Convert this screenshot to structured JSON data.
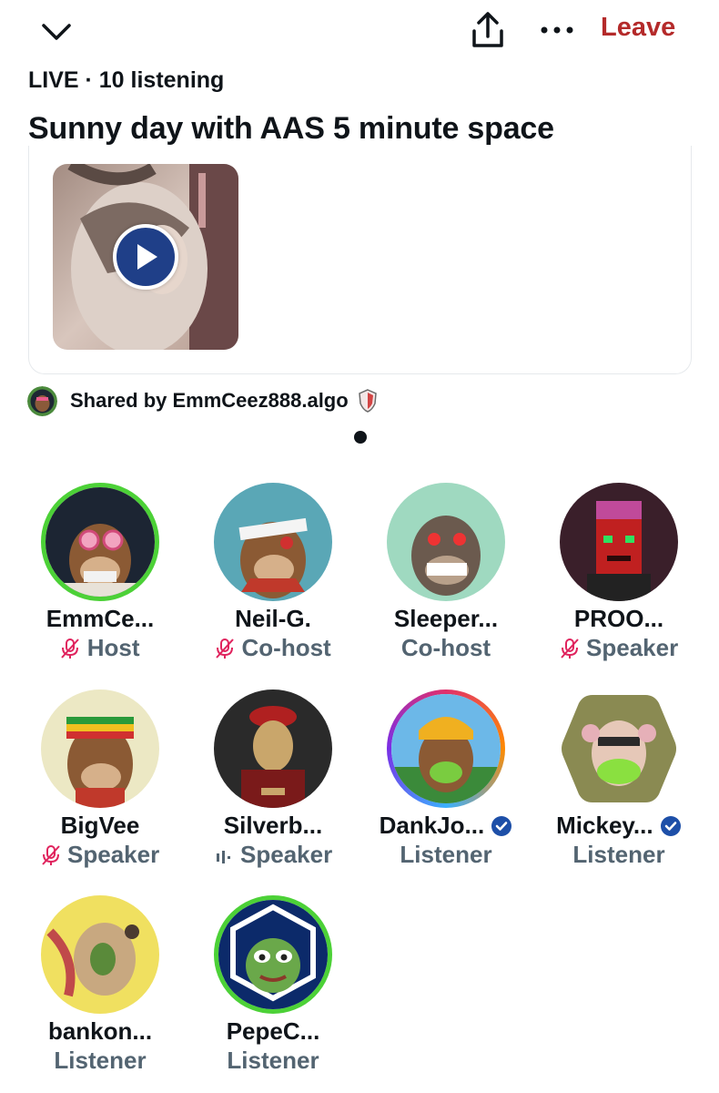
{
  "header": {
    "collapse_icon": "chevron-down-icon",
    "share_icon": "share-icon",
    "more_icon": "more-icon",
    "leave_label": "Leave",
    "leave_color": "#b42a2a"
  },
  "space": {
    "status": "LIVE · 10 listening",
    "title": "Sunny day with AAS 5 minute space"
  },
  "shared_post": {
    "play_icon": "play-icon",
    "shared_by": "Shared by EmmCeez888.algo",
    "page_indicator": "1"
  },
  "participants": [
    {
      "name": "EmmCe...",
      "role": "Host",
      "mic": "muted",
      "verified": false,
      "ring": "green"
    },
    {
      "name": "Neil-G.",
      "role": "Co-host",
      "mic": "muted",
      "verified": false,
      "ring": "none"
    },
    {
      "name": "Sleeper...",
      "role": "Co-host",
      "mic": "none",
      "verified": false,
      "ring": "none"
    },
    {
      "name": "PROO...",
      "role": "Speaker",
      "mic": "muted",
      "verified": false,
      "ring": "none"
    },
    {
      "name": "BigVee",
      "role": "Speaker",
      "mic": "muted",
      "verified": false,
      "ring": "none"
    },
    {
      "name": "Silverb...",
      "role": "Speaker",
      "mic": "speaking",
      "verified": false,
      "ring": "none"
    },
    {
      "name": "DankJo...",
      "role": "Listener",
      "mic": "none",
      "verified": true,
      "ring": "gradient"
    },
    {
      "name": "Mickey...",
      "role": "Listener",
      "mic": "none",
      "verified": true,
      "ring": "hexagon"
    },
    {
      "name": "bankon...",
      "role": "Listener",
      "mic": "none",
      "verified": false,
      "ring": "none"
    },
    {
      "name": "PepeC...",
      "role": "Listener",
      "mic": "none",
      "verified": false,
      "ring": "green"
    }
  ],
  "colors": {
    "muted_mic": "#e0245e",
    "role_text": "#536471",
    "verified": "#1d4fa8",
    "host_ring": "#4cd137"
  }
}
